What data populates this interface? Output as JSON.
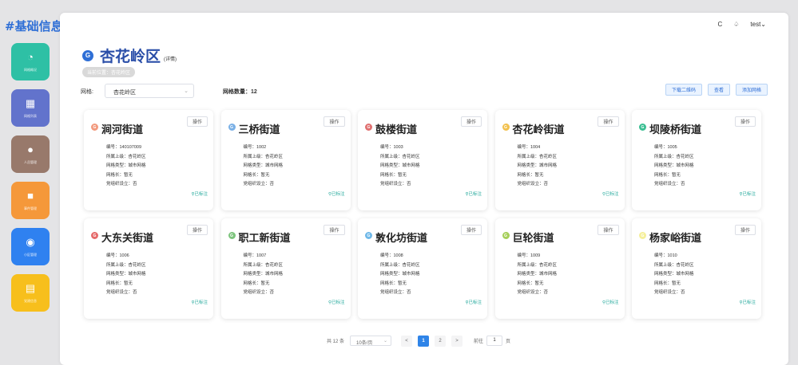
{
  "sidebar": {
    "brand": "#基础信息",
    "items": [
      {
        "label": "网格概况",
        "icon": "dashboard-icon",
        "color": "#2ec0a5"
      },
      {
        "label": "网格列表",
        "icon": "grid-table-icon",
        "color": "#6273cc"
      },
      {
        "label": "人员管理",
        "icon": "user-icon",
        "color": "#98796b"
      },
      {
        "label": "事件管理",
        "icon": "briefcase-icon",
        "color": "#f5983a"
      },
      {
        "label": "小区管理",
        "icon": "globe-icon",
        "color": "#2f81f0"
      },
      {
        "label": "党建信息",
        "icon": "document-icon",
        "color": "#f7bf1c"
      }
    ]
  },
  "topbar": {
    "refresh": "C",
    "bell": "♤",
    "user": "test"
  },
  "header": {
    "badge": "G",
    "title": "杏花岭区",
    "detail": "(详情)",
    "breadcrumb": "当前位置：杏花岭区"
  },
  "filter": {
    "label": "网格:",
    "value": "杏花岭区",
    "count_label": "网格数量：12",
    "buttons": [
      "下载二维码",
      "查看",
      "添加网格"
    ]
  },
  "cards": [
    {
      "name": "涧河街道",
      "code": "编号：140107009",
      "parent": "所属上级：杏花岭区",
      "type": "网格类型：城市网格",
      "leader": "网格长：暂无",
      "party": "党组织设立：否",
      "mark": "已标注",
      "dot": "#f29a7e"
    },
    {
      "name": "三桥街道",
      "code": "编号：1002",
      "parent": "所属上级：杏花岭区",
      "type": "网格类型：城市网格",
      "leader": "网格长：暂无",
      "party": "党组织设立：否",
      "mark": "已标注",
      "dot": "#7ab0e6"
    },
    {
      "name": "鼓楼街道",
      "code": "编号：1003",
      "parent": "所属上级：杏花岭区",
      "type": "网格类型：城市网格",
      "leader": "网格长：暂无",
      "party": "党组织设立：否",
      "mark": "已标注",
      "dot": "#e07070"
    },
    {
      "name": "杏花岭街道",
      "code": "编号：1004",
      "parent": "所属上级：杏花岭区",
      "type": "网格类型：城市网格",
      "leader": "网格长：暂无",
      "party": "党组织设立：否",
      "mark": "已标注",
      "dot": "#f2c14e"
    },
    {
      "name": "坝陵桥街道",
      "code": "编号：1005",
      "parent": "所属上级：杏花岭区",
      "type": "网格类型：城市网格",
      "leader": "网格长：暂无",
      "party": "党组织设立：否",
      "mark": "已标注",
      "dot": "#3bbf93"
    },
    {
      "name": "大东关街道",
      "code": "编号：1006",
      "parent": "所属上级：杏花岭区",
      "type": "网格类型：城市网格",
      "leader": "网格长：暂无",
      "party": "党组织设立：否",
      "mark": "已标注",
      "dot": "#e56a6a"
    },
    {
      "name": "职工新街道",
      "code": "编号：1007",
      "parent": "所属上级：杏花岭区",
      "type": "网格类型：城市网格",
      "leader": "网格长：暂无",
      "party": "党组织设立：否",
      "mark": "已标注",
      "dot": "#7dc47d"
    },
    {
      "name": "敦化坊街道",
      "code": "编号：1008",
      "parent": "所属上级：杏花岭区",
      "type": "网格类型：城市网格",
      "leader": "网格长：暂无",
      "party": "党组织设立：否",
      "mark": "已标注",
      "dot": "#6fb8e8"
    },
    {
      "name": "巨轮街道",
      "code": "编号：1009",
      "parent": "所属上级：杏花岭区",
      "type": "网格类型：城市网格",
      "leader": "网格长：暂无",
      "party": "党组织设立：否",
      "mark": "已标注",
      "dot": "#a6cf5a"
    },
    {
      "name": "杨家峪街道",
      "code": "编号：1010",
      "parent": "所属上级：杏花岭区",
      "type": "网格类型：城市网格",
      "leader": "网格长：暂无",
      "party": "党组织设立：否",
      "mark": "已标注",
      "dot": "#f5ef9a"
    }
  ],
  "card_op_label": "操作",
  "card_dot_letter": "G",
  "pager": {
    "total": "共 12 条",
    "page_size": "10条/页",
    "prev": "<",
    "pages": [
      "1",
      "2"
    ],
    "next": ">",
    "goto_label": "前往",
    "goto_value": "1",
    "goto_suffix": "页"
  }
}
